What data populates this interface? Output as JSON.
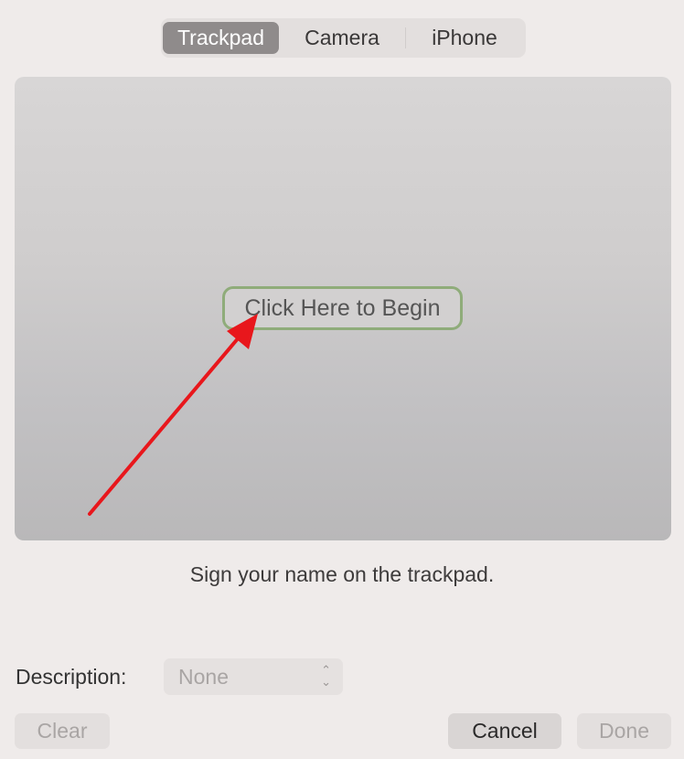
{
  "tabs": [
    {
      "label": "Trackpad",
      "selected": true
    },
    {
      "label": "Camera",
      "selected": false
    },
    {
      "label": "iPhone",
      "selected": false
    }
  ],
  "pad": {
    "begin_label": "Click Here to Begin",
    "hint": "Sign your name on the trackpad."
  },
  "description": {
    "label": "Description:",
    "value": "None",
    "enabled": false
  },
  "buttons": {
    "clear": "Clear",
    "cancel": "Cancel",
    "done": "Done"
  },
  "colors": {
    "highlight": "#8fac7a",
    "annotation_arrow": "#e8171c"
  }
}
